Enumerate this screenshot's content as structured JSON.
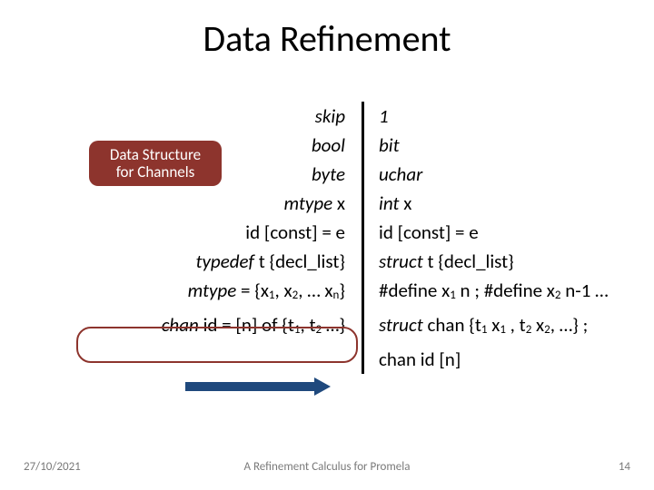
{
  "title": "Data Refinement",
  "badge": {
    "line1": "Data Structure",
    "line2": "for Channels"
  },
  "left": {
    "l1": "skip",
    "l2": "bool",
    "l3": "byte",
    "l4_a": "mtype",
    "l4_b": " x",
    "l5_a": "id [const] = e",
    "l6_a": "typedef",
    "l6_b": " t {decl_list}",
    "l7_a": "mtype",
    "l7_b": " = {x",
    "l7_c": ", x",
    "l7_d": ", … x",
    "l7_e": "}",
    "l8_a": "chan",
    "l8_b": " id = [n] of {t",
    "l8_c": ", t",
    "l8_d": " …}"
  },
  "right": {
    "r1": "1",
    "r2": "bit",
    "r3": "uchar",
    "r4_a": "int",
    "r4_b": " x",
    "r5": "id [const] = e",
    "r6_a": "struct",
    "r6_b": " t {decl_list}",
    "r7_a": "#define x",
    "r7_b": " n ; #define x",
    "r7_c": " n-1 …",
    "r8_a": "struct",
    "r8_b": " chan {t",
    "r8_c": " x",
    "r8_d": " , t",
    "r8_e": " x",
    "r8_f": ", …} ;",
    "r9": "chan id [n]"
  },
  "footer": {
    "date": "27/10/2021",
    "title": "A Refinement Calculus for Promela",
    "page": "14"
  },
  "sub": {
    "s1": "1",
    "s2": "2",
    "sn": "n"
  }
}
